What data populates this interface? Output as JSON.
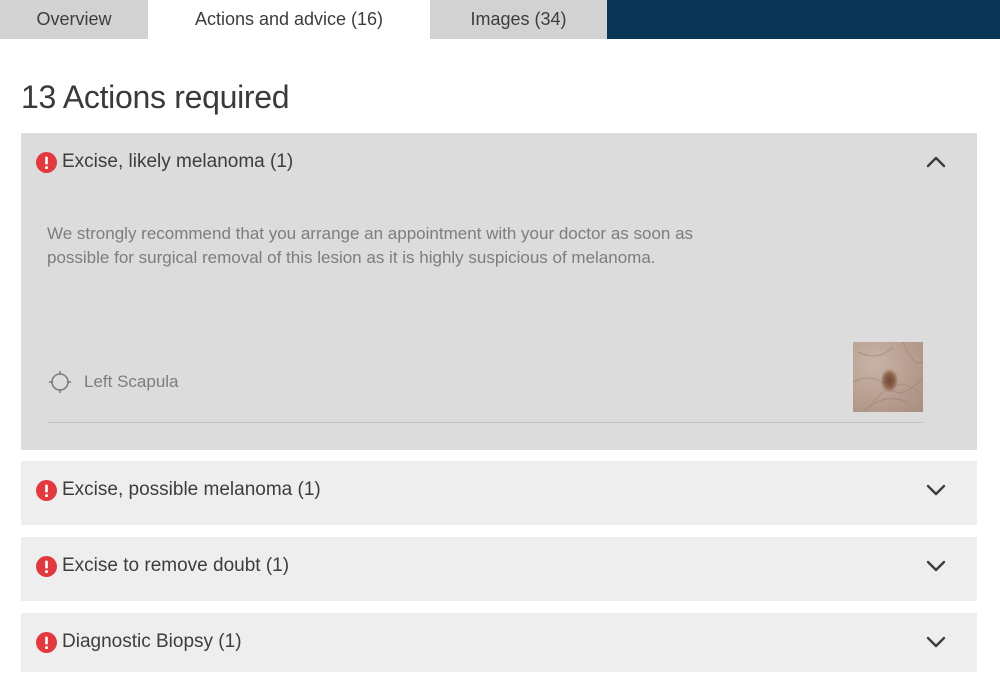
{
  "tabs": [
    {
      "label": "Overview"
    },
    {
      "label": "Actions and advice (16)"
    },
    {
      "label": "Images (34)"
    }
  ],
  "page_title": "13 Actions required",
  "colors": {
    "tabbar": "#0b3554",
    "alert": "#e0393f",
    "panel_open": "#dcdcdc",
    "panel_closed": "#eeeeee"
  },
  "actions": [
    {
      "title": "Excise, likely melanoma (1)",
      "expanded": true,
      "description": "We strongly recommend that you arrange an appointment with your doctor as soon as possible for surgical removal of this lesion as it is highly suspicious of melanoma.",
      "location": "Left Scapula",
      "location_icon": "crosshair-icon",
      "toggle_icon": "chevron-up-icon"
    },
    {
      "title": "Excise, possible melanoma (1)",
      "expanded": false,
      "toggle_icon": "chevron-down-icon"
    },
    {
      "title": "Excise to remove doubt (1)",
      "expanded": false,
      "toggle_icon": "chevron-down-icon"
    },
    {
      "title": "Diagnostic Biopsy (1)",
      "expanded": false,
      "toggle_icon": "chevron-down-icon"
    }
  ]
}
